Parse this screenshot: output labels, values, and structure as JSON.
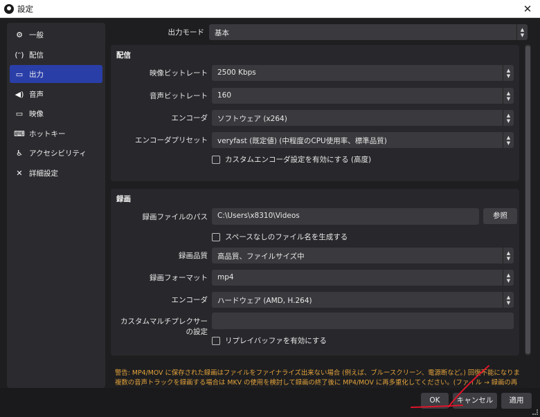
{
  "window": {
    "title": "設定",
    "close_label": "✕"
  },
  "sidebar": {
    "items": [
      {
        "label": "一般",
        "icon": "gear-icon",
        "glyph": "⚙",
        "active": false
      },
      {
        "label": "配信",
        "icon": "broadcast-icon",
        "glyph": "(ᵔ)",
        "active": false
      },
      {
        "label": "出力",
        "icon": "output-icon",
        "glyph": "▭",
        "active": true
      },
      {
        "label": "音声",
        "icon": "speaker-icon",
        "glyph": "◀)",
        "active": false
      },
      {
        "label": "映像",
        "icon": "monitor-icon",
        "glyph": "▭",
        "active": false
      },
      {
        "label": "ホットキー",
        "icon": "keyboard-icon",
        "glyph": "⌨",
        "active": false
      },
      {
        "label": "アクセシビリティ",
        "icon": "accessibility-icon",
        "glyph": "♿",
        "active": false
      },
      {
        "label": "詳細設定",
        "icon": "wrench-icon",
        "glyph": "✕",
        "active": false
      }
    ]
  },
  "output_mode": {
    "label": "出力モード",
    "value": "基本"
  },
  "streaming": {
    "title": "配信",
    "video_bitrate": {
      "label": "映像ビットレート",
      "value": "2500 Kbps"
    },
    "audio_bitrate": {
      "label": "音声ビットレート",
      "value": "160"
    },
    "encoder": {
      "label": "エンコーダ",
      "value": "ソフトウェア (x264)"
    },
    "encoder_preset": {
      "label": "エンコーダプリセット",
      "value": "veryfast (既定値) (中程度のCPU使用率、標準品質)"
    },
    "custom_encoder_checkbox": {
      "label": "カスタムエンコーダ設定を有効にする (高度)",
      "checked": false
    }
  },
  "recording": {
    "title": "録画",
    "path": {
      "label": "録画ファイルのパス",
      "value": "C:\\Users\\x8310\\Videos",
      "browse_label": "参照"
    },
    "no_space_checkbox": {
      "label": "スペースなしのファイル名を生成する",
      "checked": false
    },
    "quality": {
      "label": "録画品質",
      "value": "高品質、ファイルサイズ中"
    },
    "format": {
      "label": "録画フォーマット",
      "value": "mp4"
    },
    "encoder": {
      "label": "エンコーダ",
      "value": "ハードウェア (AMD, H.264)"
    },
    "muxer": {
      "label": "カスタムマルチプレクサーの設定",
      "value": ""
    },
    "replay_buffer_checkbox": {
      "label": "リプレイバッファを有効にする",
      "checked": false
    }
  },
  "warning": {
    "line1": "警告: MP4/MOV に保存された録画はファイルをファイナライズ出来ない場合 (例えば、ブルースクリーン、電源断など。) 回復不能になります。",
    "line2": "複数の音声トラックを録画する場合は MKV の使用を検討して録画の終了後に MP4/MOV に再多重化してください。(ファイル → 録画の再"
  },
  "buttons": {
    "ok": "OK",
    "cancel": "キャンセル",
    "apply": "適用"
  },
  "colors": {
    "accent": "#2a3ea8",
    "warning": "#e3a33b",
    "annotation": "#e0142a"
  }
}
